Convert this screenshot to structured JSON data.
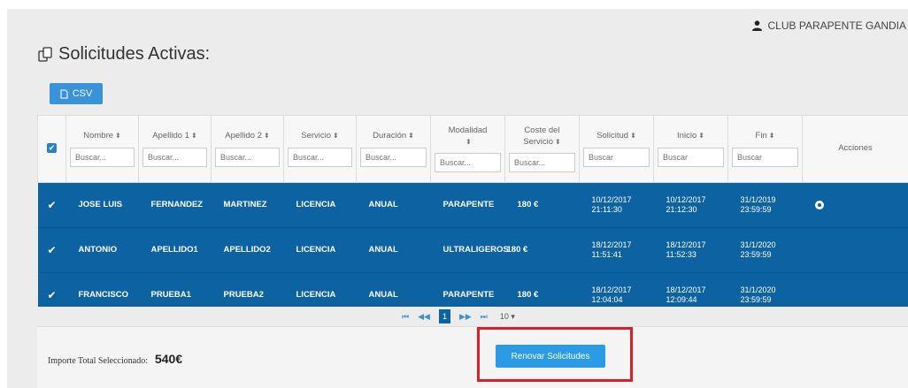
{
  "user": {
    "name": "CLUB PARAPENTE GANDIA",
    "icon": "user-icon"
  },
  "panel": {
    "title": "Solicitudes Activas:",
    "icon": "copy-icon"
  },
  "toolbar": {
    "csv_label": "CSV",
    "csv_icon": "file-icon"
  },
  "table": {
    "columns": [
      {
        "label": "Nombre",
        "placeholder": "Buscar..."
      },
      {
        "label": "Apellido 1",
        "placeholder": "Buscar..."
      },
      {
        "label": "Apellido 2",
        "placeholder": "Buscar..."
      },
      {
        "label": "Servicio",
        "placeholder": "Buscar..."
      },
      {
        "label": "Duración",
        "placeholder": "Buscar..."
      },
      {
        "label": "Modalidad",
        "placeholder": "Buscar..."
      },
      {
        "label": "Coste del Servicio",
        "placeholder": "Buscar..."
      },
      {
        "label": "Solicitud",
        "placeholder": "Buscar"
      },
      {
        "label": "Inicio",
        "placeholder": "Buscar"
      },
      {
        "label": "Fin",
        "placeholder": "Buscar"
      }
    ],
    "actions_label": "Acciones",
    "rows": [
      {
        "nombre": "JOSE LUIS",
        "apellido1": "FERNANDEZ",
        "apellido2": "MARTINEZ",
        "servicio": "LICENCIA",
        "duracion": "ANUAL",
        "modalidad": "PARAPENTE",
        "coste": "180 €",
        "solicitud_fecha": "10/12/2017",
        "solicitud_hora": "21:11:30",
        "inicio_fecha": "10/12/2017",
        "inicio_hora": "21:12:30",
        "fin_fecha": "31/1/2019",
        "fin_hora": "23:59:59"
      },
      {
        "nombre": "ANTONIO",
        "apellido1": "APELLIDO1",
        "apellido2": "APELLIDO2",
        "servicio": "LICENCIA",
        "duracion": "ANUAL",
        "modalidad": "ULTRALIGEROS",
        "coste": "180 €",
        "solicitud_fecha": "18/12/2017",
        "solicitud_hora": "11:51:41",
        "inicio_fecha": "18/12/2017",
        "inicio_hora": "11:52:33",
        "fin_fecha": "31/1/2020",
        "fin_hora": "23:59:59"
      },
      {
        "nombre": "FRANCISCO",
        "apellido1": "PRUEBA1",
        "apellido2": "PRUEBA2",
        "servicio": "LICENCIA",
        "duracion": "ANUAL",
        "modalidad": "PARAPENTE",
        "coste": "180 €",
        "solicitud_fecha": "18/12/2017",
        "solicitud_hora": "12:04:04",
        "inicio_fecha": "18/12/2017",
        "inicio_hora": "12:09:44",
        "fin_fecha": "31/1/2020",
        "fin_hora": "23:59:59"
      }
    ]
  },
  "pagination": {
    "first": "⏮",
    "prev": "◀◀",
    "current": "1",
    "next": "▶▶",
    "last": "⏭",
    "page_size": "10 ▾"
  },
  "footer": {
    "total_label": "Importe Total Seleccionado:",
    "total_value": "540€",
    "renew_label": "Renovar Solicitudes"
  },
  "colors": {
    "selected_row": "#0d63a2",
    "button": "#2b9be6",
    "highlight": "#d6202a"
  }
}
